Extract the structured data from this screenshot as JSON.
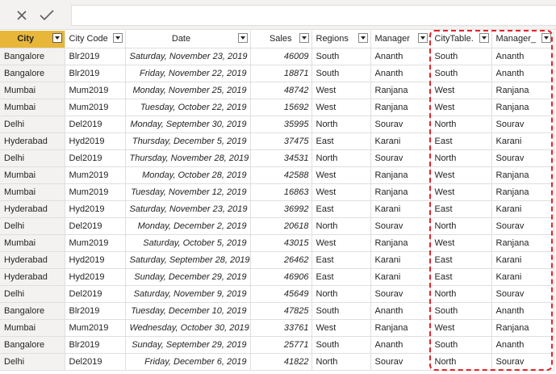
{
  "toolbar": {
    "cancel_icon": "close-icon",
    "commit_icon": "checkmark-icon",
    "formula_value": ""
  },
  "columns": [
    {
      "label": "City"
    },
    {
      "label": "City Code"
    },
    {
      "label": "Date"
    },
    {
      "label": "Sales"
    },
    {
      "label": "Regions"
    },
    {
      "label": "Manager"
    },
    {
      "label": "CityTable."
    },
    {
      "label": "Manager_"
    }
  ],
  "rows": [
    [
      "Bangalore",
      "Blr2019",
      "Saturday, November 23, 2019",
      "46009",
      "South",
      "Ananth",
      "South",
      "Ananth"
    ],
    [
      "Bangalore",
      "Blr2019",
      "Friday, November 22, 2019",
      "18871",
      "South",
      "Ananth",
      "South",
      "Ananth"
    ],
    [
      "Mumbai",
      "Mum2019",
      "Monday, November 25, 2019",
      "48742",
      "West",
      "Ranjana",
      "West",
      "Ranjana"
    ],
    [
      "Mumbai",
      "Mum2019",
      "Tuesday, October 22, 2019",
      "15692",
      "West",
      "Ranjana",
      "West",
      "Ranjana"
    ],
    [
      "Delhi",
      "Del2019",
      "Monday, September 30, 2019",
      "35995",
      "North",
      "Sourav",
      "North",
      "Sourav"
    ],
    [
      "Hyderabad",
      "Hyd2019",
      "Thursday, December 5, 2019",
      "37475",
      "East",
      "Karani",
      "East",
      "Karani"
    ],
    [
      "Delhi",
      "Del2019",
      "Thursday, November 28, 2019",
      "34531",
      "North",
      "Sourav",
      "North",
      "Sourav"
    ],
    [
      "Mumbai",
      "Mum2019",
      "Monday, October 28, 2019",
      "42588",
      "West",
      "Ranjana",
      "West",
      "Ranjana"
    ],
    [
      "Mumbai",
      "Mum2019",
      "Tuesday, November 12, 2019",
      "16863",
      "West",
      "Ranjana",
      "West",
      "Ranjana"
    ],
    [
      "Hyderabad",
      "Hyd2019",
      "Saturday, November 23, 2019",
      "36992",
      "East",
      "Karani",
      "East",
      "Karani"
    ],
    [
      "Delhi",
      "Del2019",
      "Monday, December 2, 2019",
      "20618",
      "North",
      "Sourav",
      "North",
      "Sourav"
    ],
    [
      "Mumbai",
      "Mum2019",
      "Saturday, October 5, 2019",
      "43015",
      "West",
      "Ranjana",
      "West",
      "Ranjana"
    ],
    [
      "Hyderabad",
      "Hyd2019",
      "Saturday, September 28, 2019",
      "26462",
      "East",
      "Karani",
      "East",
      "Karani"
    ],
    [
      "Hyderabad",
      "Hyd2019",
      "Sunday, December 29, 2019",
      "46906",
      "East",
      "Karani",
      "East",
      "Karani"
    ],
    [
      "Delhi",
      "Del2019",
      "Saturday, November 9, 2019",
      "45649",
      "North",
      "Sourav",
      "North",
      "Sourav"
    ],
    [
      "Bangalore",
      "Blr2019",
      "Tuesday, December 10, 2019",
      "47825",
      "South",
      "Ananth",
      "South",
      "Ananth"
    ],
    [
      "Mumbai",
      "Mum2019",
      "Wednesday, October 30, 2019",
      "33761",
      "West",
      "Ranjana",
      "West",
      "Ranjana"
    ],
    [
      "Bangalore",
      "Blr2019",
      "Sunday, September 29, 2019",
      "25771",
      "South",
      "Ananth",
      "South",
      "Ananth"
    ],
    [
      "Delhi",
      "Del2019",
      "Friday, December 6, 2019",
      "41822",
      "North",
      "Sourav",
      "North",
      "Sourav"
    ]
  ],
  "colors": {
    "selected_header": "#e8b73a",
    "highlight_border": "#e3242b",
    "grid_line": "#e1dfdd"
  }
}
